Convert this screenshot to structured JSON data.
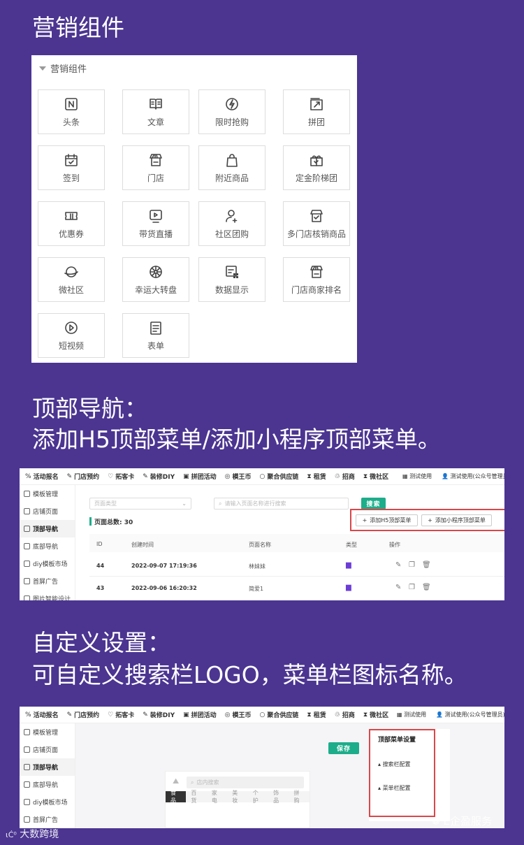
{
  "section1": {
    "heading": "营销组件",
    "panel_title": "营销组件",
    "tiles": [
      {
        "label": "头条",
        "icon": "headline-icon"
      },
      {
        "label": "文章",
        "icon": "article-icon"
      },
      {
        "label": "限时抢购",
        "icon": "flash-sale-icon"
      },
      {
        "label": "拼团",
        "icon": "group-buy-icon"
      },
      {
        "label": "签到",
        "icon": "checkin-calendar-icon"
      },
      {
        "label": "门店",
        "icon": "store-icon"
      },
      {
        "label": "附近商品",
        "icon": "shopping-bag-icon"
      },
      {
        "label": "定金阶梯团",
        "icon": "gift-box-icon"
      },
      {
        "label": "优惠券",
        "icon": "coupon-icon"
      },
      {
        "label": "带货直播",
        "icon": "live-stream-icon"
      },
      {
        "label": "社区团购",
        "icon": "community-user-icon"
      },
      {
        "label": "多门店核销商品",
        "icon": "multi-store-icon"
      },
      {
        "label": "微社区",
        "icon": "planet-icon"
      },
      {
        "label": "幸运大转盘",
        "icon": "lucky-wheel-icon"
      },
      {
        "label": "数据显示",
        "icon": "data-display-icon"
      },
      {
        "label": "门店商家排名",
        "icon": "store-ranking-icon"
      },
      {
        "label": "短视频",
        "icon": "short-video-icon"
      },
      {
        "label": "表单",
        "icon": "form-icon"
      }
    ]
  },
  "section2": {
    "heading_line1": "顶部导航：",
    "heading_line2": "添加H5顶部菜单/添加小程序顶部菜单。"
  },
  "section3": {
    "heading_line1": "自定义设置：",
    "heading_line2": "可自定义搜索栏LOGO，菜单栏图标名称。"
  },
  "admin": {
    "topnav": [
      {
        "label": "活动报名",
        "icon": "%"
      },
      {
        "label": "门店预约",
        "icon": "✎"
      },
      {
        "label": "拓客卡",
        "icon": "♡"
      },
      {
        "label": "装修DIY",
        "icon": "✎"
      },
      {
        "label": "拼团活动",
        "icon": "▣"
      },
      {
        "label": "模王币",
        "icon": "◎"
      },
      {
        "label": "聚合供应链",
        "icon": "○"
      },
      {
        "label": "租赁",
        "icon": "⧗"
      },
      {
        "label": "招商",
        "icon": "♲"
      },
      {
        "label": "微社区",
        "icon": "⧗"
      }
    ],
    "trial": "测试使用",
    "user": "测试使用(公众号管理员)",
    "sidebar": [
      "模板管理",
      "店铺页面",
      "顶部导航",
      "底部导航",
      "diy模板市场",
      "首屏广告",
      "图片智能设计"
    ]
  },
  "screen1": {
    "page_type_placeholder": "页面类型",
    "search_placeholder": "请输入页面名称进行搜索",
    "search_btn": "搜索",
    "total_label": "页面总数: 30",
    "add_h5": "添加H5顶部菜单",
    "add_mini": "添加小程序顶部菜单",
    "columns": [
      "ID",
      "创建时间",
      "页面名称",
      "类型",
      "操作"
    ],
    "rows": [
      {
        "id": "44",
        "time": "2022-09-07 17:19:36",
        "name": "林妹妹"
      },
      {
        "id": "43",
        "time": "2022-09-06 16:20:32",
        "name": "简爱1"
      }
    ]
  },
  "screen2": {
    "save_btn": "保存",
    "shop_search": "店内搜索",
    "tabs": [
      "食品",
      "百货",
      "家电",
      "美妆",
      "个护",
      "饰品",
      "拼购"
    ],
    "settings_title": "顶部菜单设置",
    "search_config": "搜索栏配置",
    "menu_config": "菜单栏配置"
  },
  "watermarks": {
    "left": "大数跨境",
    "right": "E企盈服务"
  },
  "colors": {
    "background": "#4b3591",
    "accent_green": "#1dad8a",
    "highlight_red": "#d9474a",
    "type_icon": "#6c3dd6"
  }
}
